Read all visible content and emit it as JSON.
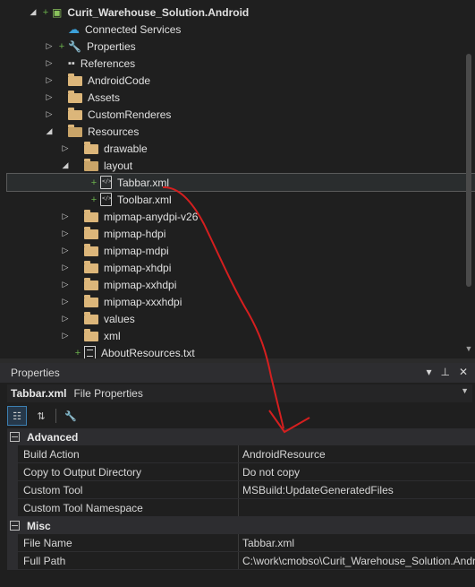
{
  "solution_explorer": {
    "items": [
      {
        "label": "Curit_Warehouse_Solution.Android",
        "indent": 0,
        "arrow": "open",
        "plus": true,
        "icon": "android-project-icon",
        "bold": true
      },
      {
        "label": "Connected Services",
        "indent": 1,
        "arrow": "none",
        "plus": false,
        "icon": "connected-services-icon"
      },
      {
        "label": "Properties",
        "indent": 1,
        "arrow": "closed",
        "plus": true,
        "icon": "wrench-icon"
      },
      {
        "label": "References",
        "indent": 1,
        "arrow": "closed",
        "plus": false,
        "icon": "references-icon"
      },
      {
        "label": "AndroidCode",
        "indent": 1,
        "arrow": "closed",
        "plus": false,
        "icon": "folder-icon"
      },
      {
        "label": "Assets",
        "indent": 1,
        "arrow": "closed",
        "plus": false,
        "icon": "folder-icon"
      },
      {
        "label": "CustomRenderes",
        "indent": 1,
        "arrow": "closed",
        "plus": false,
        "icon": "folder-icon"
      },
      {
        "label": "Resources",
        "indent": 1,
        "arrow": "open",
        "plus": false,
        "icon": "folder-open-icon"
      },
      {
        "label": "drawable",
        "indent": 2,
        "arrow": "closed",
        "plus": false,
        "icon": "folder-icon"
      },
      {
        "label": "layout",
        "indent": 2,
        "arrow": "open",
        "plus": false,
        "icon": "folder-open-icon"
      },
      {
        "label": "Tabbar.xml",
        "indent": 3,
        "arrow": "none",
        "plus": true,
        "icon": "xml-file-icon",
        "selected": true
      },
      {
        "label": "Toolbar.xml",
        "indent": 3,
        "arrow": "none",
        "plus": true,
        "icon": "xml-file-icon"
      },
      {
        "label": "mipmap-anydpi-v26",
        "indent": 2,
        "arrow": "closed",
        "plus": false,
        "icon": "folder-icon"
      },
      {
        "label": "mipmap-hdpi",
        "indent": 2,
        "arrow": "closed",
        "plus": false,
        "icon": "folder-icon"
      },
      {
        "label": "mipmap-mdpi",
        "indent": 2,
        "arrow": "closed",
        "plus": false,
        "icon": "folder-icon"
      },
      {
        "label": "mipmap-xhdpi",
        "indent": 2,
        "arrow": "closed",
        "plus": false,
        "icon": "folder-icon"
      },
      {
        "label": "mipmap-xxhdpi",
        "indent": 2,
        "arrow": "closed",
        "plus": false,
        "icon": "folder-icon"
      },
      {
        "label": "mipmap-xxxhdpi",
        "indent": 2,
        "arrow": "closed",
        "plus": false,
        "icon": "folder-icon"
      },
      {
        "label": "values",
        "indent": 2,
        "arrow": "closed",
        "plus": false,
        "icon": "folder-icon"
      },
      {
        "label": "xml",
        "indent": 2,
        "arrow": "closed",
        "plus": false,
        "icon": "folder-icon"
      },
      {
        "label": "AboutResources.txt",
        "indent": 2,
        "arrow": "none",
        "plus": true,
        "icon": "text-file-icon"
      }
    ]
  },
  "properties": {
    "title": "Properties",
    "object_name": "Tabbar.xml",
    "object_kind": "File Properties",
    "categories": [
      {
        "name": "Advanced",
        "rows": [
          {
            "name": "Build Action",
            "value": "AndroidResource"
          },
          {
            "name": "Copy to Output Directory",
            "value": "Do not copy"
          },
          {
            "name": "Custom Tool",
            "value": "MSBuild:UpdateGeneratedFiles"
          },
          {
            "name": "Custom Tool Namespace",
            "value": ""
          }
        ]
      },
      {
        "name": "Misc",
        "rows": [
          {
            "name": "File Name",
            "value": "Tabbar.xml"
          },
          {
            "name": "Full Path",
            "value": "C:\\work\\cmobso\\Curit_Warehouse_Solution.Andr"
          }
        ]
      }
    ]
  },
  "colors": {
    "annotation": "#d41f1f",
    "background": "#1f1f1f",
    "selection": "#2a2d2e",
    "folder": "#dcb67a"
  }
}
